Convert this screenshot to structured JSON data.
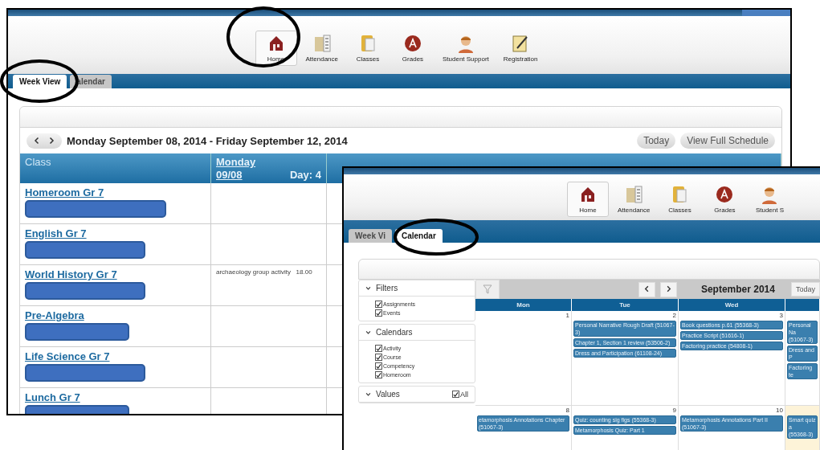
{
  "week_view_window": {
    "nav": [
      {
        "label": "Home",
        "selected": true
      },
      {
        "label": "Attendance",
        "selected": false
      },
      {
        "label": "Classes",
        "selected": false
      },
      {
        "label": "Grades",
        "selected": false
      },
      {
        "label": "Student Support",
        "selected": false
      },
      {
        "label": "Registration",
        "selected": false
      }
    ],
    "tabs": [
      {
        "label": "Week View",
        "selected": true
      },
      {
        "label": "alendar",
        "selected": false
      }
    ],
    "date_range": "Monday September 08, 2014 - Friday September 12, 2014",
    "buttons": [
      "Today",
      "View Full Schedule"
    ],
    "table": {
      "class_column": "Class",
      "day_column": {
        "day": "Monday",
        "date": "09/08",
        "cycle": "Day: 4"
      },
      "rows": [
        {
          "class": "Homeroom Gr 7",
          "monday": ""
        },
        {
          "class": "English Gr 7",
          "monday": ""
        },
        {
          "class": "World History Gr 7",
          "monday": "archaeology group activity   18.00"
        },
        {
          "class": "Pre-Algebra",
          "monday": ""
        },
        {
          "class": "Life Science Gr 7",
          "monday": ""
        },
        {
          "class": "Lunch Gr 7",
          "monday": ""
        }
      ]
    }
  },
  "calendar_window": {
    "nav": [
      {
        "label": "Home",
        "selected": true
      },
      {
        "label": "Attendance",
        "selected": false
      },
      {
        "label": "Classes",
        "selected": false
      },
      {
        "label": "Grades",
        "selected": false
      },
      {
        "label": "Student S",
        "selected": false
      }
    ],
    "tabs": [
      {
        "label": "Week Vi",
        "selected": false
      },
      {
        "label": "Calendar",
        "selected": true
      }
    ],
    "filters": [
      {
        "title": "Filters",
        "items": [
          {
            "label": "Assignments",
            "checked": true
          },
          {
            "label": "Events",
            "checked": true
          }
        ]
      },
      {
        "title": "Calendars",
        "items": [
          {
            "label": "Activity",
            "checked": true
          },
          {
            "label": "Course",
            "checked": true
          },
          {
            "label": "Competency",
            "checked": true
          },
          {
            "label": "Homeroom",
            "checked": true
          }
        ]
      },
      {
        "title": "Values",
        "all": {
          "label": "All",
          "checked": true
        }
      }
    ],
    "month": "September 2014",
    "today_button": "Today",
    "weekdays": [
      "Mon",
      "Tue",
      "Wed"
    ],
    "weeks": [
      {
        "days": [
          {
            "number": "1",
            "highlighted": false
          },
          {
            "number": "2",
            "highlighted": false,
            "events": [
              "Personal Narrative Rough Draft (51067-3)",
              "Chapter 1, Section 1 review (53506-2)",
              "Dress and Participation (61108-24)"
            ]
          },
          {
            "number": "3",
            "highlighted": false,
            "events": [
              "Book questions p.61 (55368-3)",
              "Practice Script (51616-1)",
              "Factoring practice (54808-1)"
            ]
          },
          {
            "highlighted": false,
            "events": [
              "Personal Na\n(51067-3)",
              "Dress and P",
              "Factoring te"
            ]
          }
        ]
      },
      {
        "days": [
          {
            "number": "8",
            "highlighted": false,
            "events": [
              "etamorphosis Annotations Chapter (51067-3)"
            ]
          },
          {
            "number": "9",
            "highlighted": false,
            "events": [
              "Quiz: counting sig figs (55368-3)",
              "Metamorphosis Quiz: Part 1"
            ]
          },
          {
            "number": "10",
            "highlighted": false,
            "events": [
              "Metamorphosis Annotations Part II (51067-3)"
            ]
          },
          {
            "highlighted": true,
            "events": [
              "Smart quiz a\n(55368-3)"
            ]
          }
        ]
      }
    ]
  }
}
